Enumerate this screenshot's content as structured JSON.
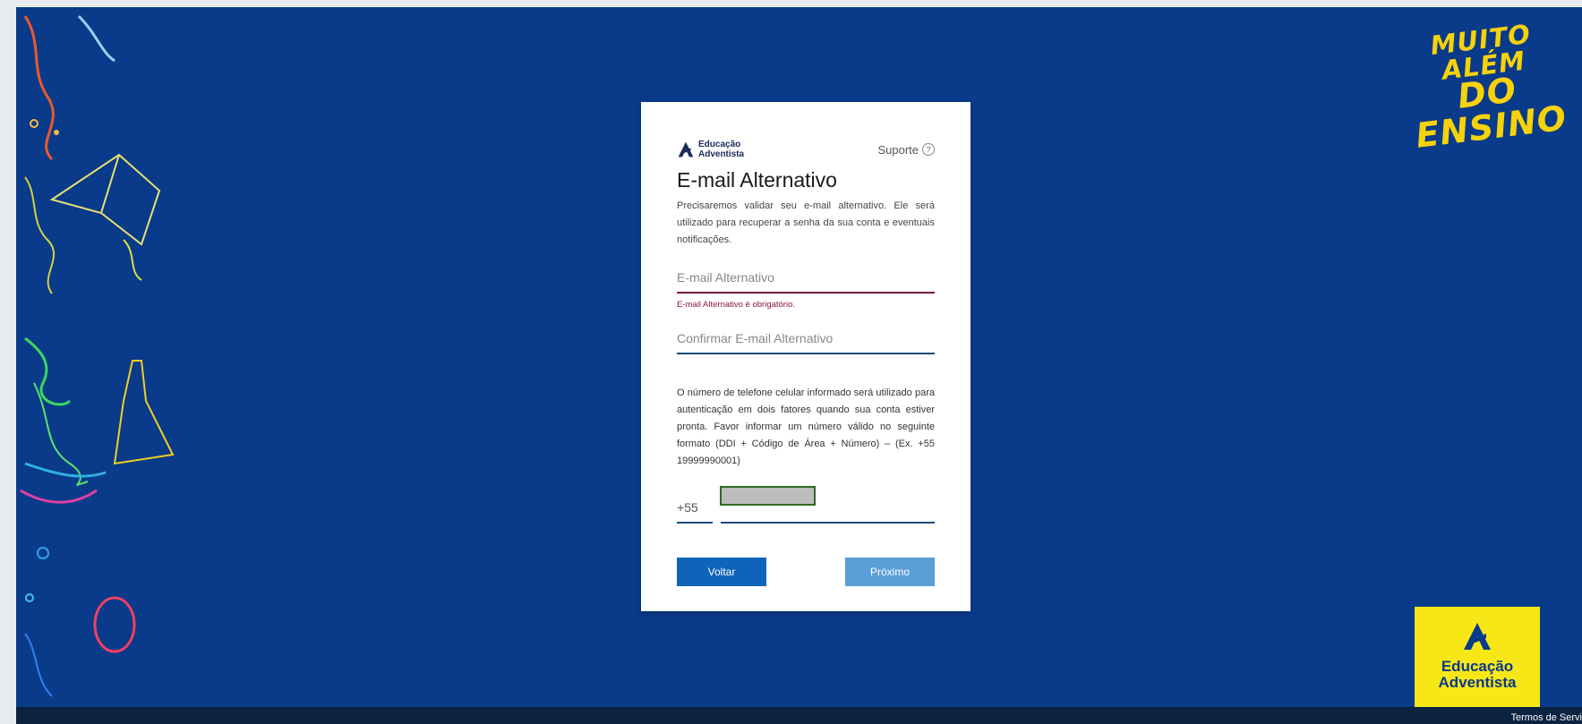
{
  "card": {
    "logo_line1": "Educação",
    "logo_line2": "Adventista",
    "support_label": "Suporte",
    "support_icon": "?",
    "title": "E-mail Alternativo",
    "description": "Precisaremos validar seu e-mail alternativo. Ele será utilizado para recuperar a senha da sua conta e eventuais notificações.",
    "email_placeholder": "E-mail Alternativo",
    "email_value": "",
    "email_error": "E-mail Alternativo é obrigatório.",
    "confirm_placeholder": "Confirmar E-mail Alternativo",
    "confirm_value": "",
    "phone_description": "O número de telefone celular informado será utilizado para autenticação em dois fatores quando sua conta estiver pronta. Favor informar um número válido no seguinte formato (DDI + Código de Área + Número) – (Ex. +55 19999990001)",
    "ddi": "+55",
    "back_label": "Voltar",
    "next_label": "Próximo"
  },
  "slogan": {
    "line1": "MUITO ALÉM",
    "line2": "DO ENSINO"
  },
  "corner_brand": {
    "line1": "Educação",
    "line2": "Adventista"
  },
  "footer": {
    "terms_link": "Termos de Servi"
  },
  "colors": {
    "background": "#0a3a8a",
    "primary_button": "#0f63b8",
    "disabled_button": "#5b9fd8",
    "error": "#8a1535",
    "slogan": "#f6d20a",
    "corner_logo_bg": "#f7e717"
  },
  "icons": {
    "brand_logo": "educacao-adventista-logo-icon",
    "help": "help-circle-icon"
  }
}
